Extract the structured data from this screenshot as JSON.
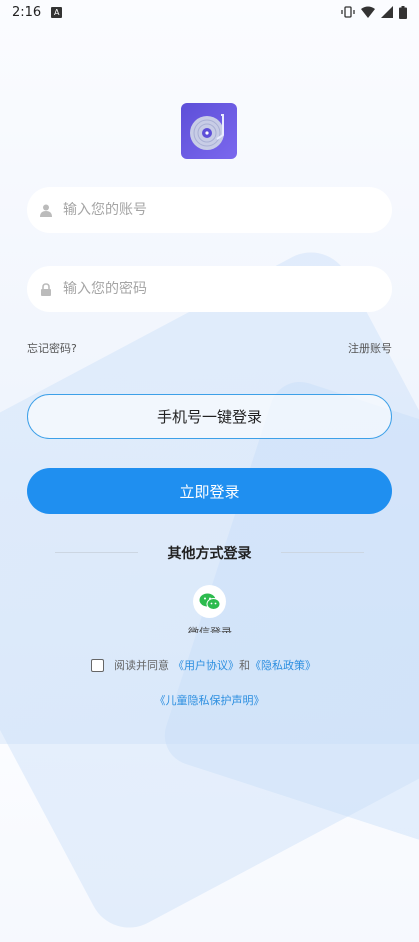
{
  "status_bar": {
    "time": "2:16",
    "notification_letter": "A"
  },
  "login": {
    "account_placeholder": "输入您的账号",
    "password_placeholder": "输入您的密码",
    "forgot_password": "忘记密码?",
    "register": "注册账号",
    "phone_login": "手机号一键登录",
    "login_now": "立即登录",
    "other_methods": "其他方式登录",
    "wechat_label": "微信登录"
  },
  "agreement": {
    "prefix": "阅读并同意",
    "user_agreement": "《用户协议》",
    "and": "和",
    "privacy_policy": "《隐私政策》",
    "children_privacy": "《儿童隐私保护声明》"
  },
  "colors": {
    "primary": "#1f8ff0",
    "logo": "#6a5ae0",
    "link": "#2c8fe0"
  }
}
